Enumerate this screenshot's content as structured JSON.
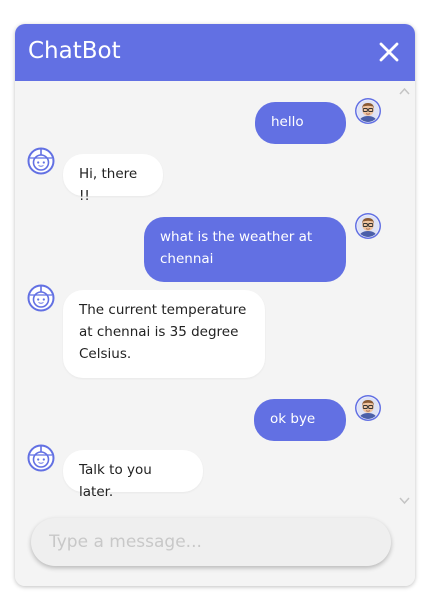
{
  "header": {
    "title": "ChatBot",
    "close_icon": "close-icon"
  },
  "colors": {
    "accent": "#6270e3",
    "window_bg": "#f4f4f4",
    "bot_bubble": "#ffffff"
  },
  "messages": [
    {
      "sender": "user",
      "text": "hello",
      "avatar": "user-avatar-icon"
    },
    {
      "sender": "bot",
      "text": "Hi, there !!",
      "avatar": "bot-avatar-icon"
    },
    {
      "sender": "user",
      "text": "what is the weather at chennai",
      "avatar": "user-avatar-icon"
    },
    {
      "sender": "bot",
      "text": "The current temperature at chennai is 35 degree Celsius.",
      "avatar": "bot-avatar-icon"
    },
    {
      "sender": "user",
      "text": "ok bye",
      "avatar": "user-avatar-icon"
    },
    {
      "sender": "bot",
      "text": "Talk to you later.",
      "avatar": "bot-avatar-icon"
    }
  ],
  "input": {
    "placeholder": "Type a message...",
    "value": ""
  }
}
